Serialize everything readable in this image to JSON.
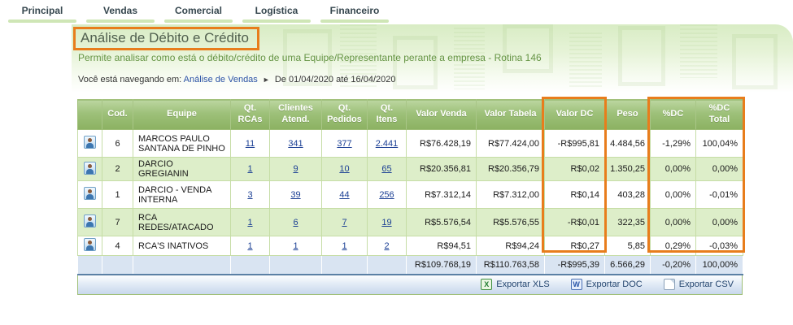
{
  "nav": {
    "tabs": [
      {
        "label": "Principal"
      },
      {
        "label": "Vendas"
      },
      {
        "label": "Comercial"
      },
      {
        "label": "Logística"
      },
      {
        "label": "Financeiro"
      }
    ]
  },
  "page": {
    "title": "Análise de Débito e Crédito",
    "subtitle": "Permite analisar como está o débito/crédito de uma Equipe/Representante perante a empresa - Rotina 146",
    "breadcrumb": {
      "prefix": "Você está navegando em:",
      "link": "Análise de Vendas",
      "arrow": "►",
      "range": "De 01/04/2020 até 16/04/2020"
    }
  },
  "table": {
    "headers": {
      "cod": "Cod.",
      "equipe": "Equipe",
      "qt_rcas": "Qt. RCAs",
      "clientes_atend": "Clientes Atend.",
      "qt_pedidos": "Qt. Pedidos",
      "qt_itens": "Qt. Itens",
      "valor_venda": "Valor Venda",
      "valor_tabela": "Valor Tabela",
      "valor_dc": "Valor DC",
      "peso": "Peso",
      "pdc": "%DC",
      "pdc_total": "%DC Total"
    },
    "rows": [
      {
        "cod": "6",
        "equipe": "MARCOS PAULO SANTANA DE PINHO",
        "qt_rcas": "11",
        "clientes_atend": "341",
        "qt_pedidos": "377",
        "qt_itens": "2.441",
        "valor_venda": "R$76.428,19",
        "valor_tabela": "R$77.424,00",
        "valor_dc": "-R$995,81",
        "peso": "4.484,56",
        "pdc": "-1,29%",
        "pdc_total": "100,04%"
      },
      {
        "cod": "2",
        "equipe": "DARCIO GREGIANIN",
        "qt_rcas": "1",
        "clientes_atend": "9",
        "qt_pedidos": "10",
        "qt_itens": "65",
        "valor_venda": "R$20.356,81",
        "valor_tabela": "R$20.356,79",
        "valor_dc": "R$0,02",
        "peso": "1.350,25",
        "pdc": "0,00%",
        "pdc_total": "0,00%"
      },
      {
        "cod": "1",
        "equipe": "DARCIO - VENDA INTERNA",
        "qt_rcas": "3",
        "clientes_atend": "39",
        "qt_pedidos": "44",
        "qt_itens": "256",
        "valor_venda": "R$7.312,14",
        "valor_tabela": "R$7.312,00",
        "valor_dc": "R$0,14",
        "peso": "403,28",
        "pdc": "0,00%",
        "pdc_total": "-0,01%"
      },
      {
        "cod": "7",
        "equipe": "RCA REDES/ATACADO",
        "qt_rcas": "1",
        "clientes_atend": "6",
        "qt_pedidos": "7",
        "qt_itens": "19",
        "valor_venda": "R$5.576,54",
        "valor_tabela": "R$5.576,55",
        "valor_dc": "-R$0,01",
        "peso": "322,35",
        "pdc": "0,00%",
        "pdc_total": "0,00%"
      },
      {
        "cod": "4",
        "equipe": "RCA'S INATIVOS",
        "qt_rcas": "1",
        "clientes_atend": "1",
        "qt_pedidos": "1",
        "qt_itens": "2",
        "valor_venda": "R$94,51",
        "valor_tabela": "R$94,24",
        "valor_dc": "R$0,27",
        "peso": "5,85",
        "pdc": "0,29%",
        "pdc_total": "-0,03%"
      }
    ],
    "totals": {
      "valor_venda": "R$109.768,19",
      "valor_tabela": "R$110.763,58",
      "valor_dc": "-R$995,39",
      "peso": "6.566,29",
      "pdc": "-0,20%",
      "pdc_total": "100,00%"
    }
  },
  "footer": {
    "export_xls": "Exportar XLS",
    "export_doc": "Exportar DOC",
    "export_csv": "Exportar CSV",
    "xls_glyph": "X",
    "doc_glyph": "W"
  },
  "colors": {
    "accent_orange": "#E87D1C",
    "header_green": "#8FB466",
    "row_alt_green": "#DDEEC9",
    "link_blue": "#1B3F94",
    "totals_blue": "#D9E4F2"
  }
}
